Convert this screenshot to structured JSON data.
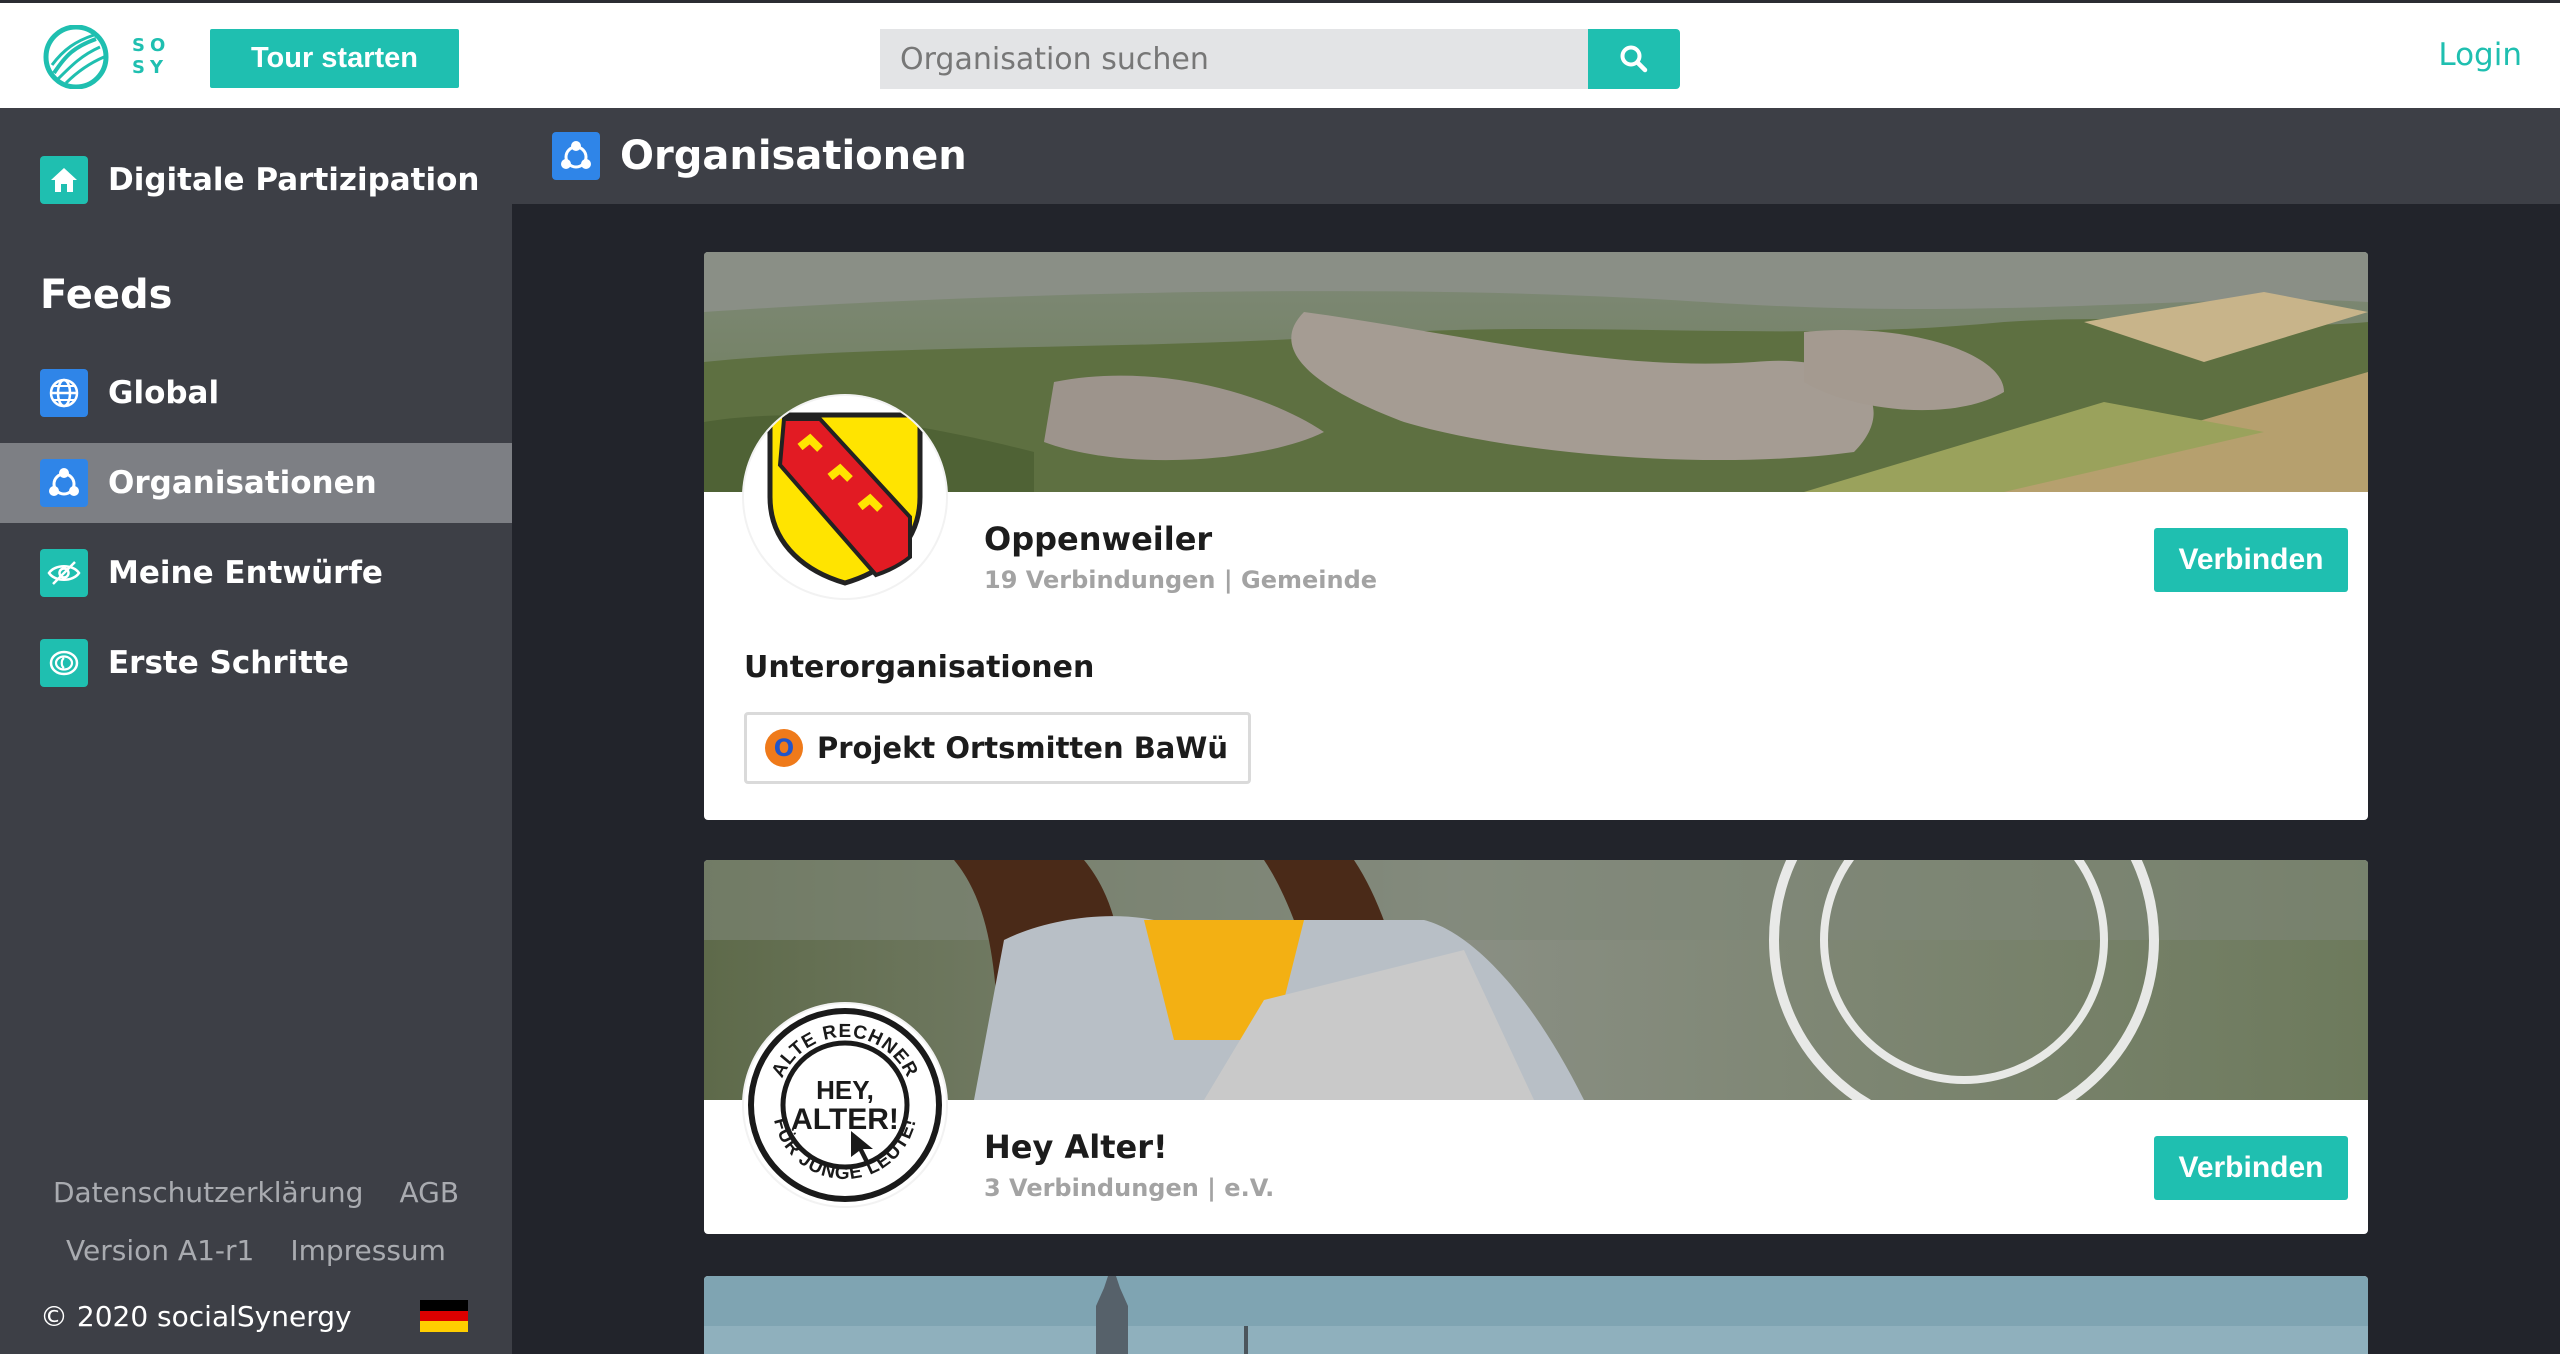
{
  "topbar": {
    "logo_letters": [
      "S",
      "O",
      "S",
      "Y"
    ],
    "tour_label": "Tour starten",
    "search_placeholder": "Organisation suchen",
    "login_label": "Login"
  },
  "sidebar": {
    "home_label": "Digitale Partizipation",
    "feeds_heading": "Feeds",
    "items": [
      {
        "label": "Global",
        "icon": "globe-icon",
        "color": "#2f85e8"
      },
      {
        "label": "Organisationen",
        "icon": "organisation-icon",
        "color": "#2f85e8",
        "active": true
      },
      {
        "label": "Meine Entwürfe",
        "icon": "eye-slash-icon",
        "color": "#1fbfb0"
      },
      {
        "label": "Erste Schritte",
        "icon": "fingerprint-icon",
        "color": "#1fbfb0"
      }
    ],
    "footer": {
      "privacy": "Datenschutzerklärung",
      "terms": "AGB",
      "version": "Version A1-r1",
      "imprint": "Impressum",
      "copyright": "© 2020 socialSynergy"
    }
  },
  "main": {
    "title": "Organisationen",
    "organisations": [
      {
        "name": "Oppenweiler",
        "meta": "19 Verbindungen | Gemeinde",
        "button": "Verbinden",
        "suborg_heading": "Unterorganisationen",
        "suborgs": [
          {
            "initial": "O",
            "name": "Projekt Ortsmitten BaWü"
          }
        ]
      },
      {
        "name": "Hey Alter!",
        "meta": "3 Verbindungen | e.V.",
        "button": "Verbinden",
        "logo_text_top": "ALTE RECHNER",
        "logo_text_mid1": "HEY,",
        "logo_text_mid2": "ALTER!",
        "logo_text_bottom": "FÜR JUNGE LEUTE!"
      }
    ]
  },
  "colors": {
    "accent": "#1fbfb0",
    "blue": "#2f85e8",
    "sidebar_bg": "#3d3f46",
    "main_bg": "#22242b"
  }
}
